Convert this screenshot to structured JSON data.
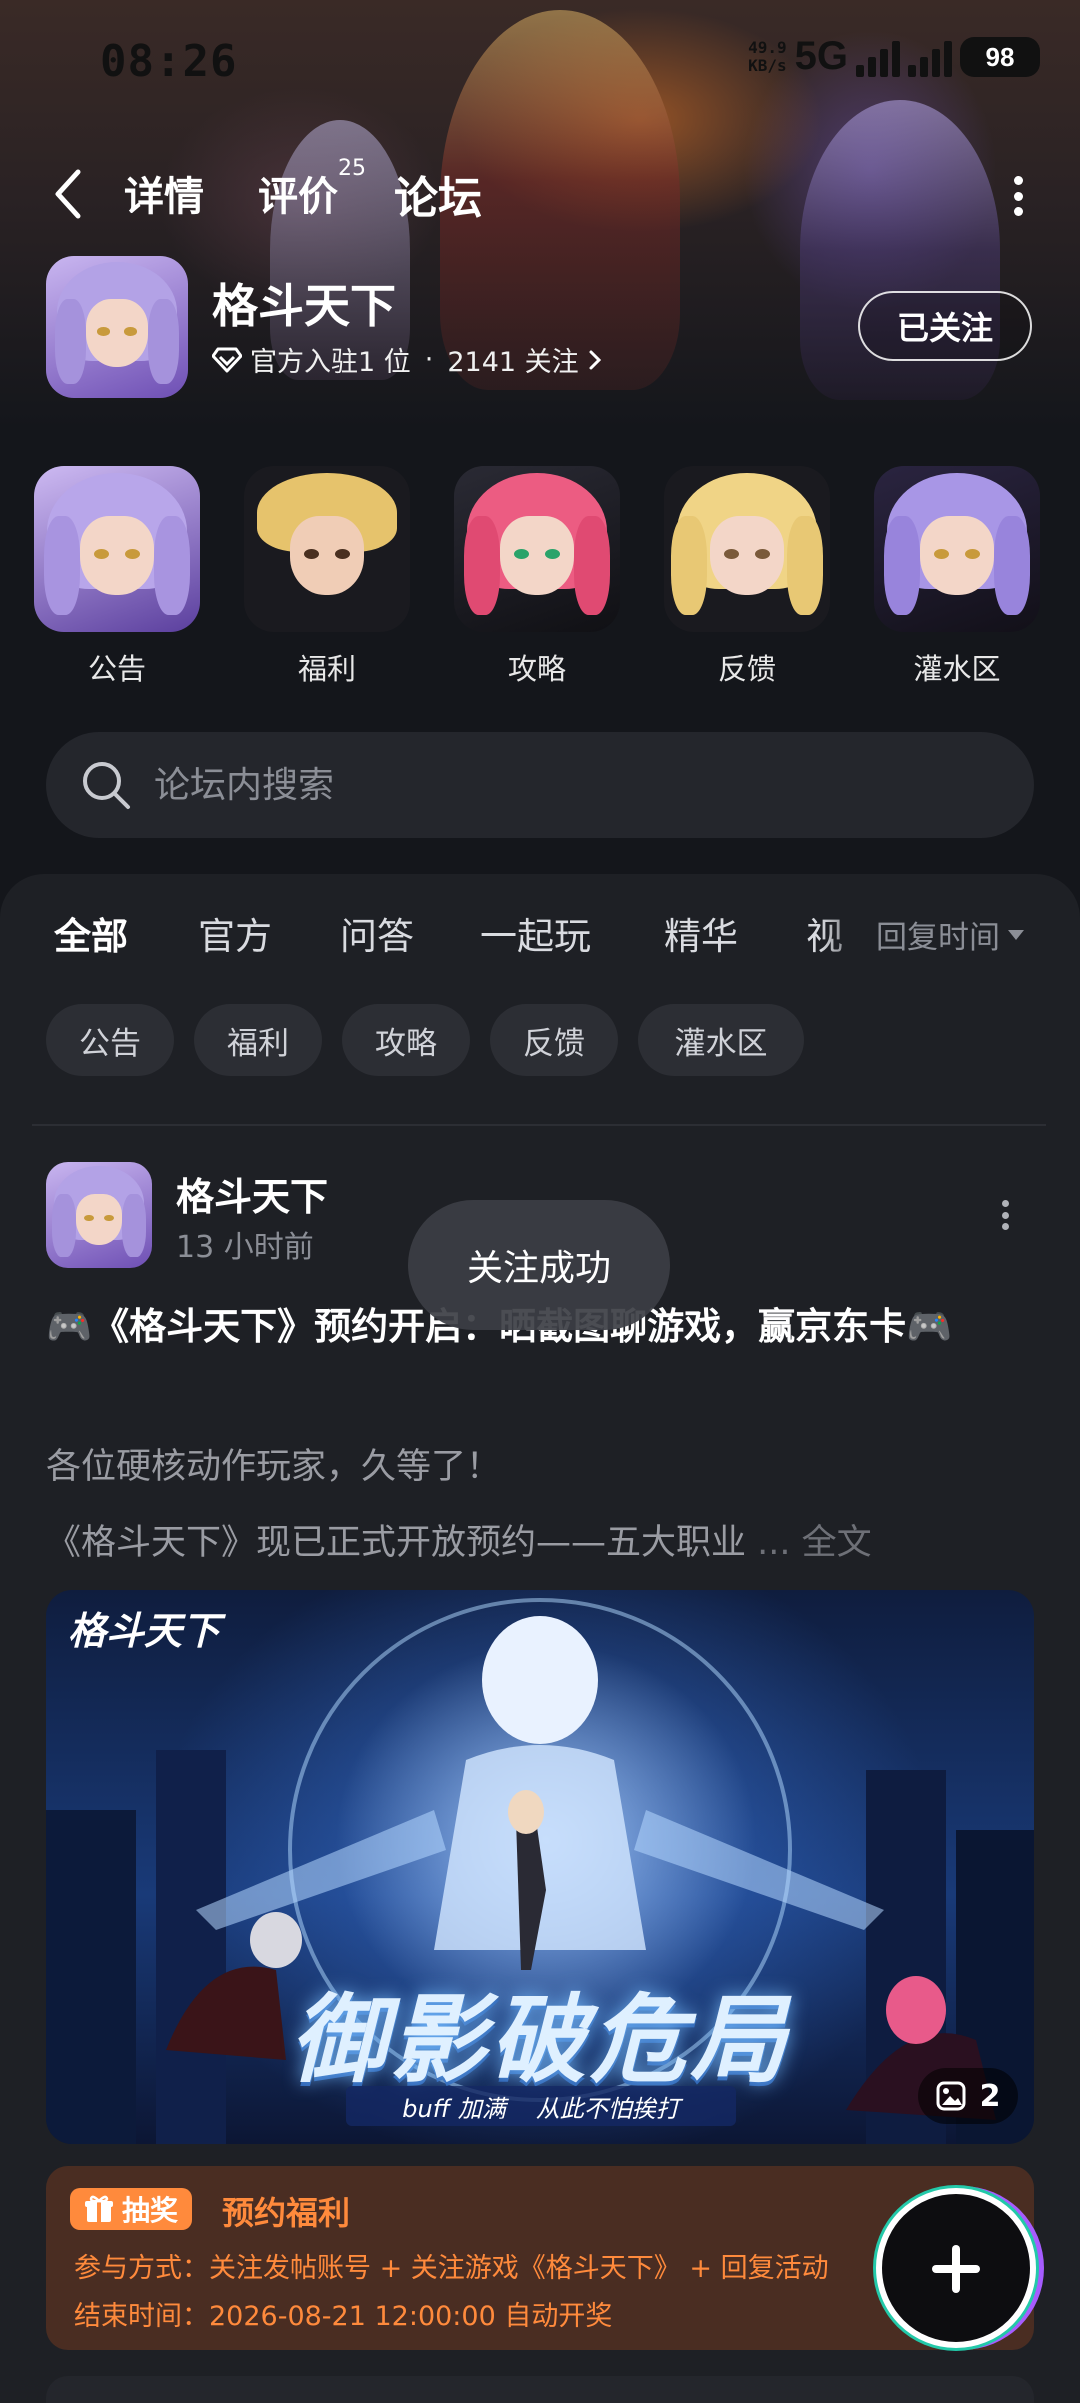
{
  "status_bar": {
    "time": "08:26",
    "speed_value": "49.9",
    "speed_unit": "KB/s",
    "network": "5G",
    "battery": "98"
  },
  "nav": {
    "tabs": [
      "详情",
      "评价",
      "论坛"
    ],
    "review_count": "25",
    "active_tab": "论坛"
  },
  "game": {
    "title": "格斗天下",
    "rank_text": "官方入驻1 位",
    "follow_count": "2141 关注",
    "follow_button": "已关注"
  },
  "sub_forums": [
    "公告",
    "福利",
    "攻略",
    "反馈",
    "灌水区"
  ],
  "search": {
    "placeholder": "论坛内搜索"
  },
  "feed_tabs": [
    "全部",
    "官方",
    "问答",
    "一起玩",
    "精华",
    "视"
  ],
  "sort_label": "回复时间",
  "chips": [
    "公告",
    "福利",
    "攻略",
    "反馈",
    "灌水区"
  ],
  "post": {
    "author": "格斗天下",
    "time": "13 小时前",
    "title": "🎮《格斗天下》预约开启：晒截图聊游戏，赢京东卡🎮",
    "body1": "各位硬核动作玩家，久等了！",
    "body2": "《格斗天下》现已正式开放预约——五大职业",
    "more": "... 全文",
    "image_logo": "格斗天下",
    "image_caption": "御影破危局",
    "image_sub1": "buff 加满",
    "image_sub2": "从此不怕挨打",
    "image_count": "2"
  },
  "toast": "关注成功",
  "lottery": {
    "badge": "抽奖",
    "title": "预约福利",
    "method": "参与方式：关注发帖账号 + 关注游戏《格斗天下》 + 回复活动",
    "end_time": "结束时间：2026-08-21 12:00:00 自动开奖"
  },
  "colors": {
    "accent": "#23c9a9",
    "lottery_orange": "#ff8a3c",
    "panel_bg": "#1e2025"
  }
}
